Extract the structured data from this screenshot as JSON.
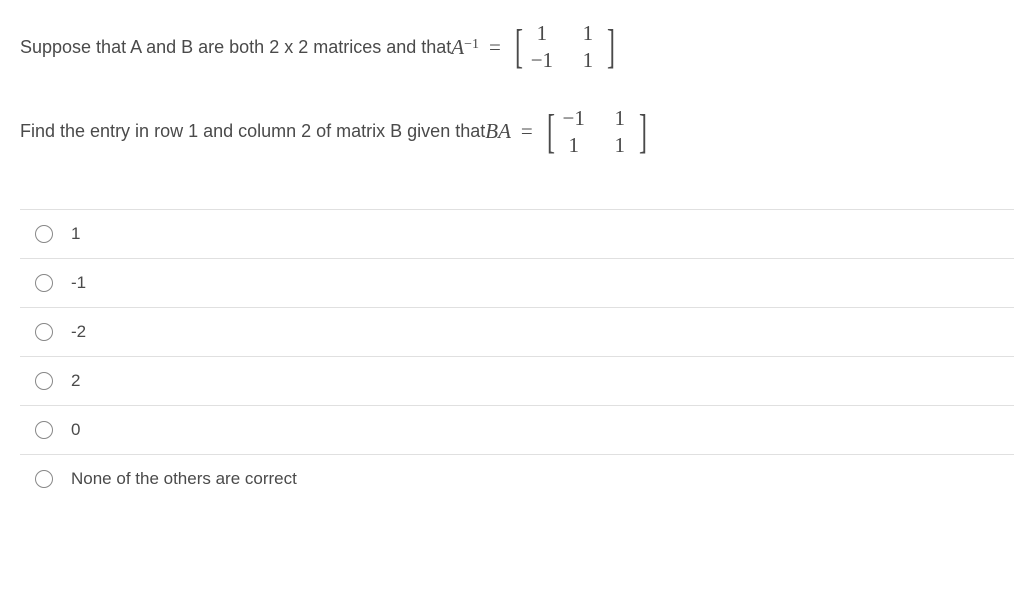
{
  "question": {
    "line1_prefix": "Suppose that A and B are both 2 x 2 matrices and that ",
    "line1_var": "A",
    "line1_exp": "−1",
    "line1_equals": "=",
    "matrix_a_inv": {
      "r1c1": "1",
      "r1c2": "1",
      "r2c1": "−1",
      "r2c2": "1"
    },
    "line2_prefix": "Find the entry in row 1 and column 2 of matrix B given that ",
    "line2_var1": "B",
    "line2_var2": "A",
    "line2_equals": "=",
    "matrix_ba": {
      "r1c1": "−1",
      "r1c2": "1",
      "r2c1": "1",
      "r2c2": "1"
    }
  },
  "options": [
    {
      "label": "1"
    },
    {
      "label": "-1"
    },
    {
      "label": "-2"
    },
    {
      "label": "2"
    },
    {
      "label": "0"
    },
    {
      "label": "None of the others are correct"
    }
  ]
}
